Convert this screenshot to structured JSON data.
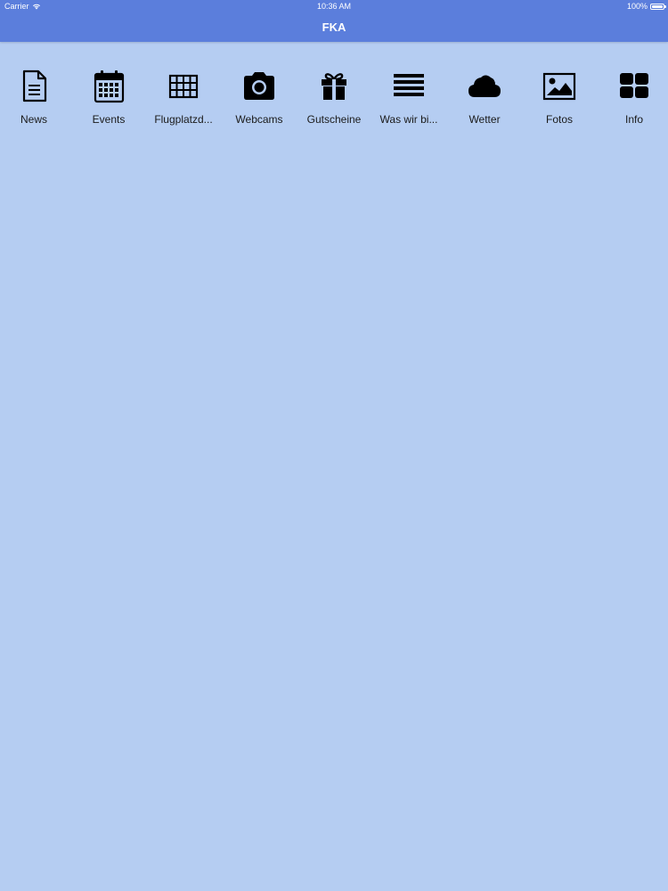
{
  "status_bar": {
    "carrier": "Carrier",
    "time": "10:36 AM",
    "battery": "100%",
    "battery_level": 1.0
  },
  "nav": {
    "title": "FKA"
  },
  "colors": {
    "header_bg": "#5b7edc",
    "page_bg": "#b5cdf2",
    "icon": "#000000",
    "label": "#1a1a1a"
  },
  "tabs": [
    {
      "label": "News",
      "icon": "document-icon"
    },
    {
      "label": "Events",
      "icon": "calendar-icon"
    },
    {
      "label": "Flugplatzd...",
      "icon": "grid-table-icon"
    },
    {
      "label": "Webcams",
      "icon": "camera-icon"
    },
    {
      "label": "Gutscheine",
      "icon": "gift-icon"
    },
    {
      "label": "Was wir bi...",
      "icon": "list-lines-icon"
    },
    {
      "label": "Wetter",
      "icon": "cloud-icon"
    },
    {
      "label": "Fotos",
      "icon": "picture-icon"
    },
    {
      "label": "Info",
      "icon": "dashboard-tiles-icon"
    }
  ]
}
